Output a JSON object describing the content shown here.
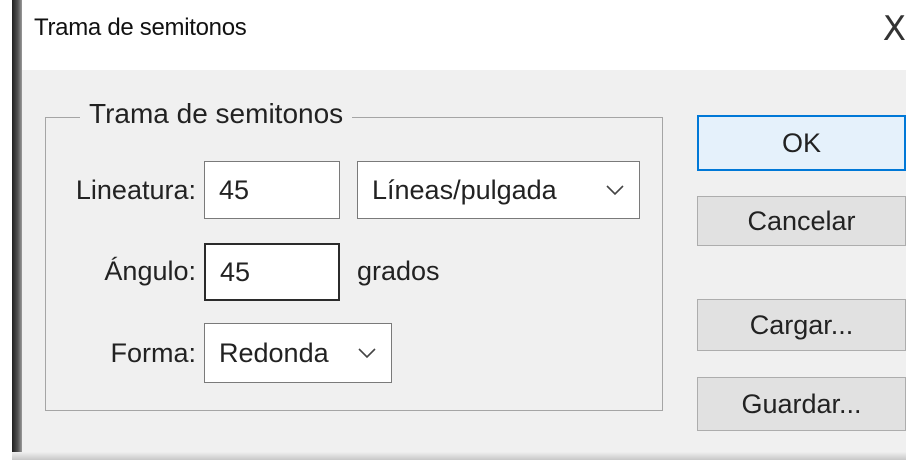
{
  "window": {
    "title": "Trama de semitonos",
    "close_glyph": "X"
  },
  "group": {
    "label": "Trama de semitonos"
  },
  "lineatura": {
    "label": "Lineatura:",
    "value": "45",
    "unit_selected": "Líneas/pulgada"
  },
  "angulo": {
    "label": "Ángulo:",
    "value": "45",
    "unit": "grados"
  },
  "forma": {
    "label": "Forma:",
    "selected": "Redonda"
  },
  "buttons": {
    "ok": "OK",
    "cancel": "Cancelar",
    "load": "Cargar...",
    "save": "Guardar..."
  },
  "colors": {
    "accent": "#0078d7",
    "dialog_bg": "#f0f0f0"
  },
  "icons": {
    "dropdown": "chevron-down-icon",
    "close": "close-icon"
  }
}
